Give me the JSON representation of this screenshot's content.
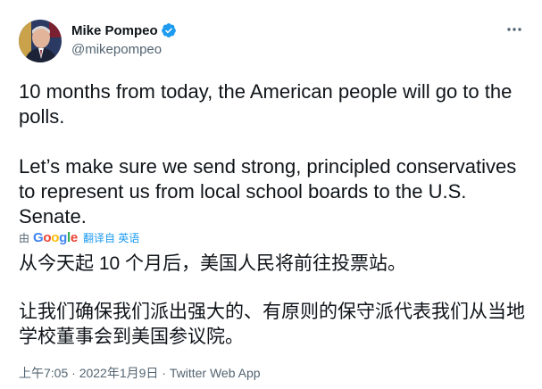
{
  "author": {
    "name": "Mike Pompeo",
    "handle": "@mikepompeo"
  },
  "tweet": {
    "paragraphs": [
      "10 months from today, the American people will go to the polls.",
      "Let’s make sure we send strong, principled conservatives to represent us from local school boards to the U.S. Senate."
    ]
  },
  "translation": {
    "prefix": "由",
    "brand": "Google",
    "link_label": "翻译自 英语",
    "paragraphs": [
      "从今天起 10 个月后，美国人民将前往投票站。",
      "让我们确保我们派出强大的、有原则的保守派代表我们从当地学校董事会到美国参议院。"
    ]
  },
  "meta": {
    "timestamp": "上午7:05 · 2022年1月9日 · Twitter Web App"
  },
  "icons": {
    "verified": "verified-badge-icon",
    "more": "more-options-icon"
  },
  "colors": {
    "text": "#0f1419",
    "secondary": "#536471",
    "accent": "#1d9bf0"
  }
}
